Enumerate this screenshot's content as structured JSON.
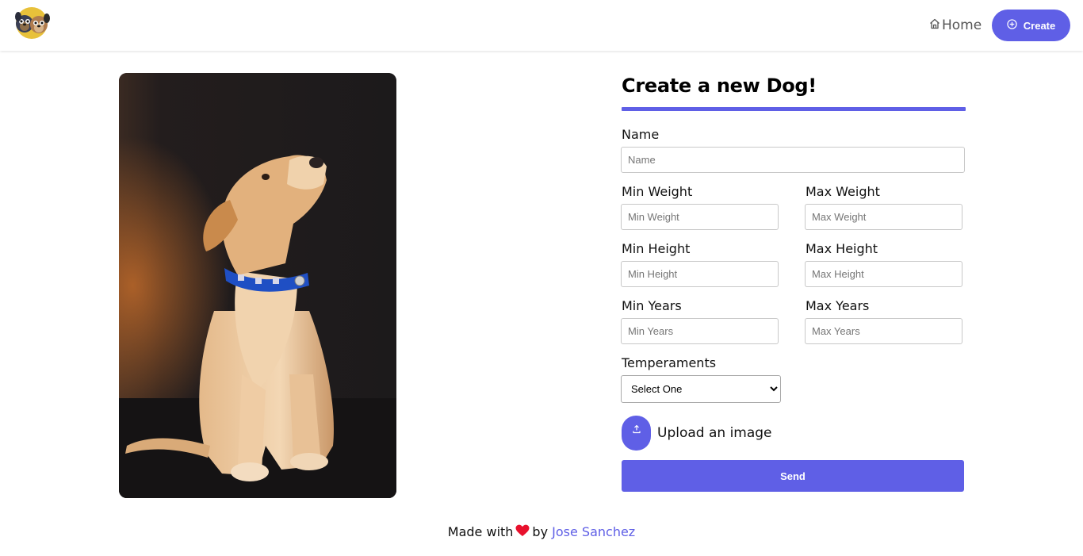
{
  "header": {
    "logo_icon": "puppy-dog-pals-logo",
    "home_label": "Home",
    "create_label": "Create",
    "accent": "#5f5fe6"
  },
  "hero": {
    "image": "puppy-photo"
  },
  "form": {
    "title": "Create a new Dog!",
    "name_label": "Name",
    "name_placeholder": "Name",
    "min_weight_label": "Min Weight",
    "min_weight_placeholder": "Min Weight",
    "max_weight_label": "Max Weight",
    "max_weight_placeholder": "Max Weight",
    "min_height_label": "Min Height",
    "min_height_placeholder": "Min Height",
    "max_height_label": "Max Height",
    "max_height_placeholder": "Max Height",
    "min_years_label": "Min Years",
    "min_years_placeholder": "Min Years",
    "max_years_label": "Max Years",
    "max_years_placeholder": "Max Years",
    "temperaments_label": "Temperaments",
    "temperaments_selected": "Select One",
    "upload_label": "Upload an image",
    "send_label": "Send"
  },
  "footer": {
    "made_with": "Made with",
    "by": "by",
    "author": "Jose Sanchez",
    "heart_color": "#e8112d"
  }
}
